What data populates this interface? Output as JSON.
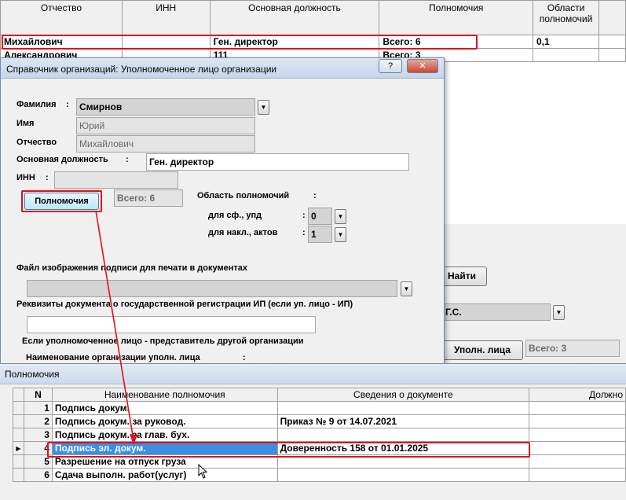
{
  "bg_table": {
    "headers": [
      "Отчество",
      "ИНН",
      "Основная должность",
      "Полномочия",
      "Области полномочий"
    ],
    "rows": [
      [
        "Михайлович",
        "",
        "Ген. директор",
        "Всего: 6",
        "0,1"
      ],
      [
        "Александрович",
        "",
        "111",
        "Всего: 3",
        ""
      ]
    ]
  },
  "dialog": {
    "title": "Справочник организаций: Уполномоченное лицо организации",
    "help_btn": "?",
    "close_btn": "✕",
    "surname_label": "Фамилия",
    "surname_value": "Смирнов",
    "name_label": "Имя",
    "name_value": "Юрий",
    "patronymic_label": "Отчество",
    "patronymic_value": "Михайлович",
    "position_label": "Основная должность",
    "position_value": "Ген. директор",
    "inn_label": "ИНН",
    "inn_value": "",
    "colon": ":",
    "powers_button": "Полномочия",
    "powers_total": "Всего: 6",
    "powers_area_label": "Область полномочий",
    "sf_label": "для сф., упд",
    "sf_value": "0",
    "nakl_label": "для накл., актов",
    "nakl_value": "1",
    "signature_file_label": "Файл изображения подписи для печати в документах",
    "signature_file_value": "",
    "registration_label": "Реквизиты документа о государственной регистрации ИП (если уп. лицо - ИП)",
    "registration_value": "",
    "representative_label": "Если уполномоченное лицо - представитель другой организации",
    "org_name_label": "Наименование организации уполн. лица"
  },
  "background_form": {
    "find_button": "Найти",
    "person_field": "Г.С.",
    "upoln_button": "Уполн. лица",
    "upoln_total": "Всего: 3"
  },
  "powers_window": {
    "title": "Полномочия",
    "headers": [
      "N",
      "Наименование полномочия",
      "Сведения о документе",
      "Должно"
    ],
    "rows": [
      {
        "n": "1",
        "name": "Подпись докум.",
        "doc": ""
      },
      {
        "n": "2",
        "name": "Подпись докум. за руковод.",
        "doc": "Приказ № 9 от 14.07.2021"
      },
      {
        "n": "3",
        "name": "Подпись докум. за глав. бух.",
        "doc": ""
      },
      {
        "n": "4",
        "name": "Подпись эл. докум.",
        "doc": "Доверенность 158 от 01.01.2025"
      },
      {
        "n": "5",
        "name": "Разрешение на отпуск груза",
        "doc": ""
      },
      {
        "n": "6",
        "name": "Сдача выполн. работ(услуг)",
        "doc": ""
      }
    ],
    "selected_row": "4",
    "row_indicator": "▶"
  },
  "colors": {
    "highlight_red": "#e0101c",
    "selection_blue": "#3a8ee6",
    "dialog_bg": "#f0f0f0"
  }
}
